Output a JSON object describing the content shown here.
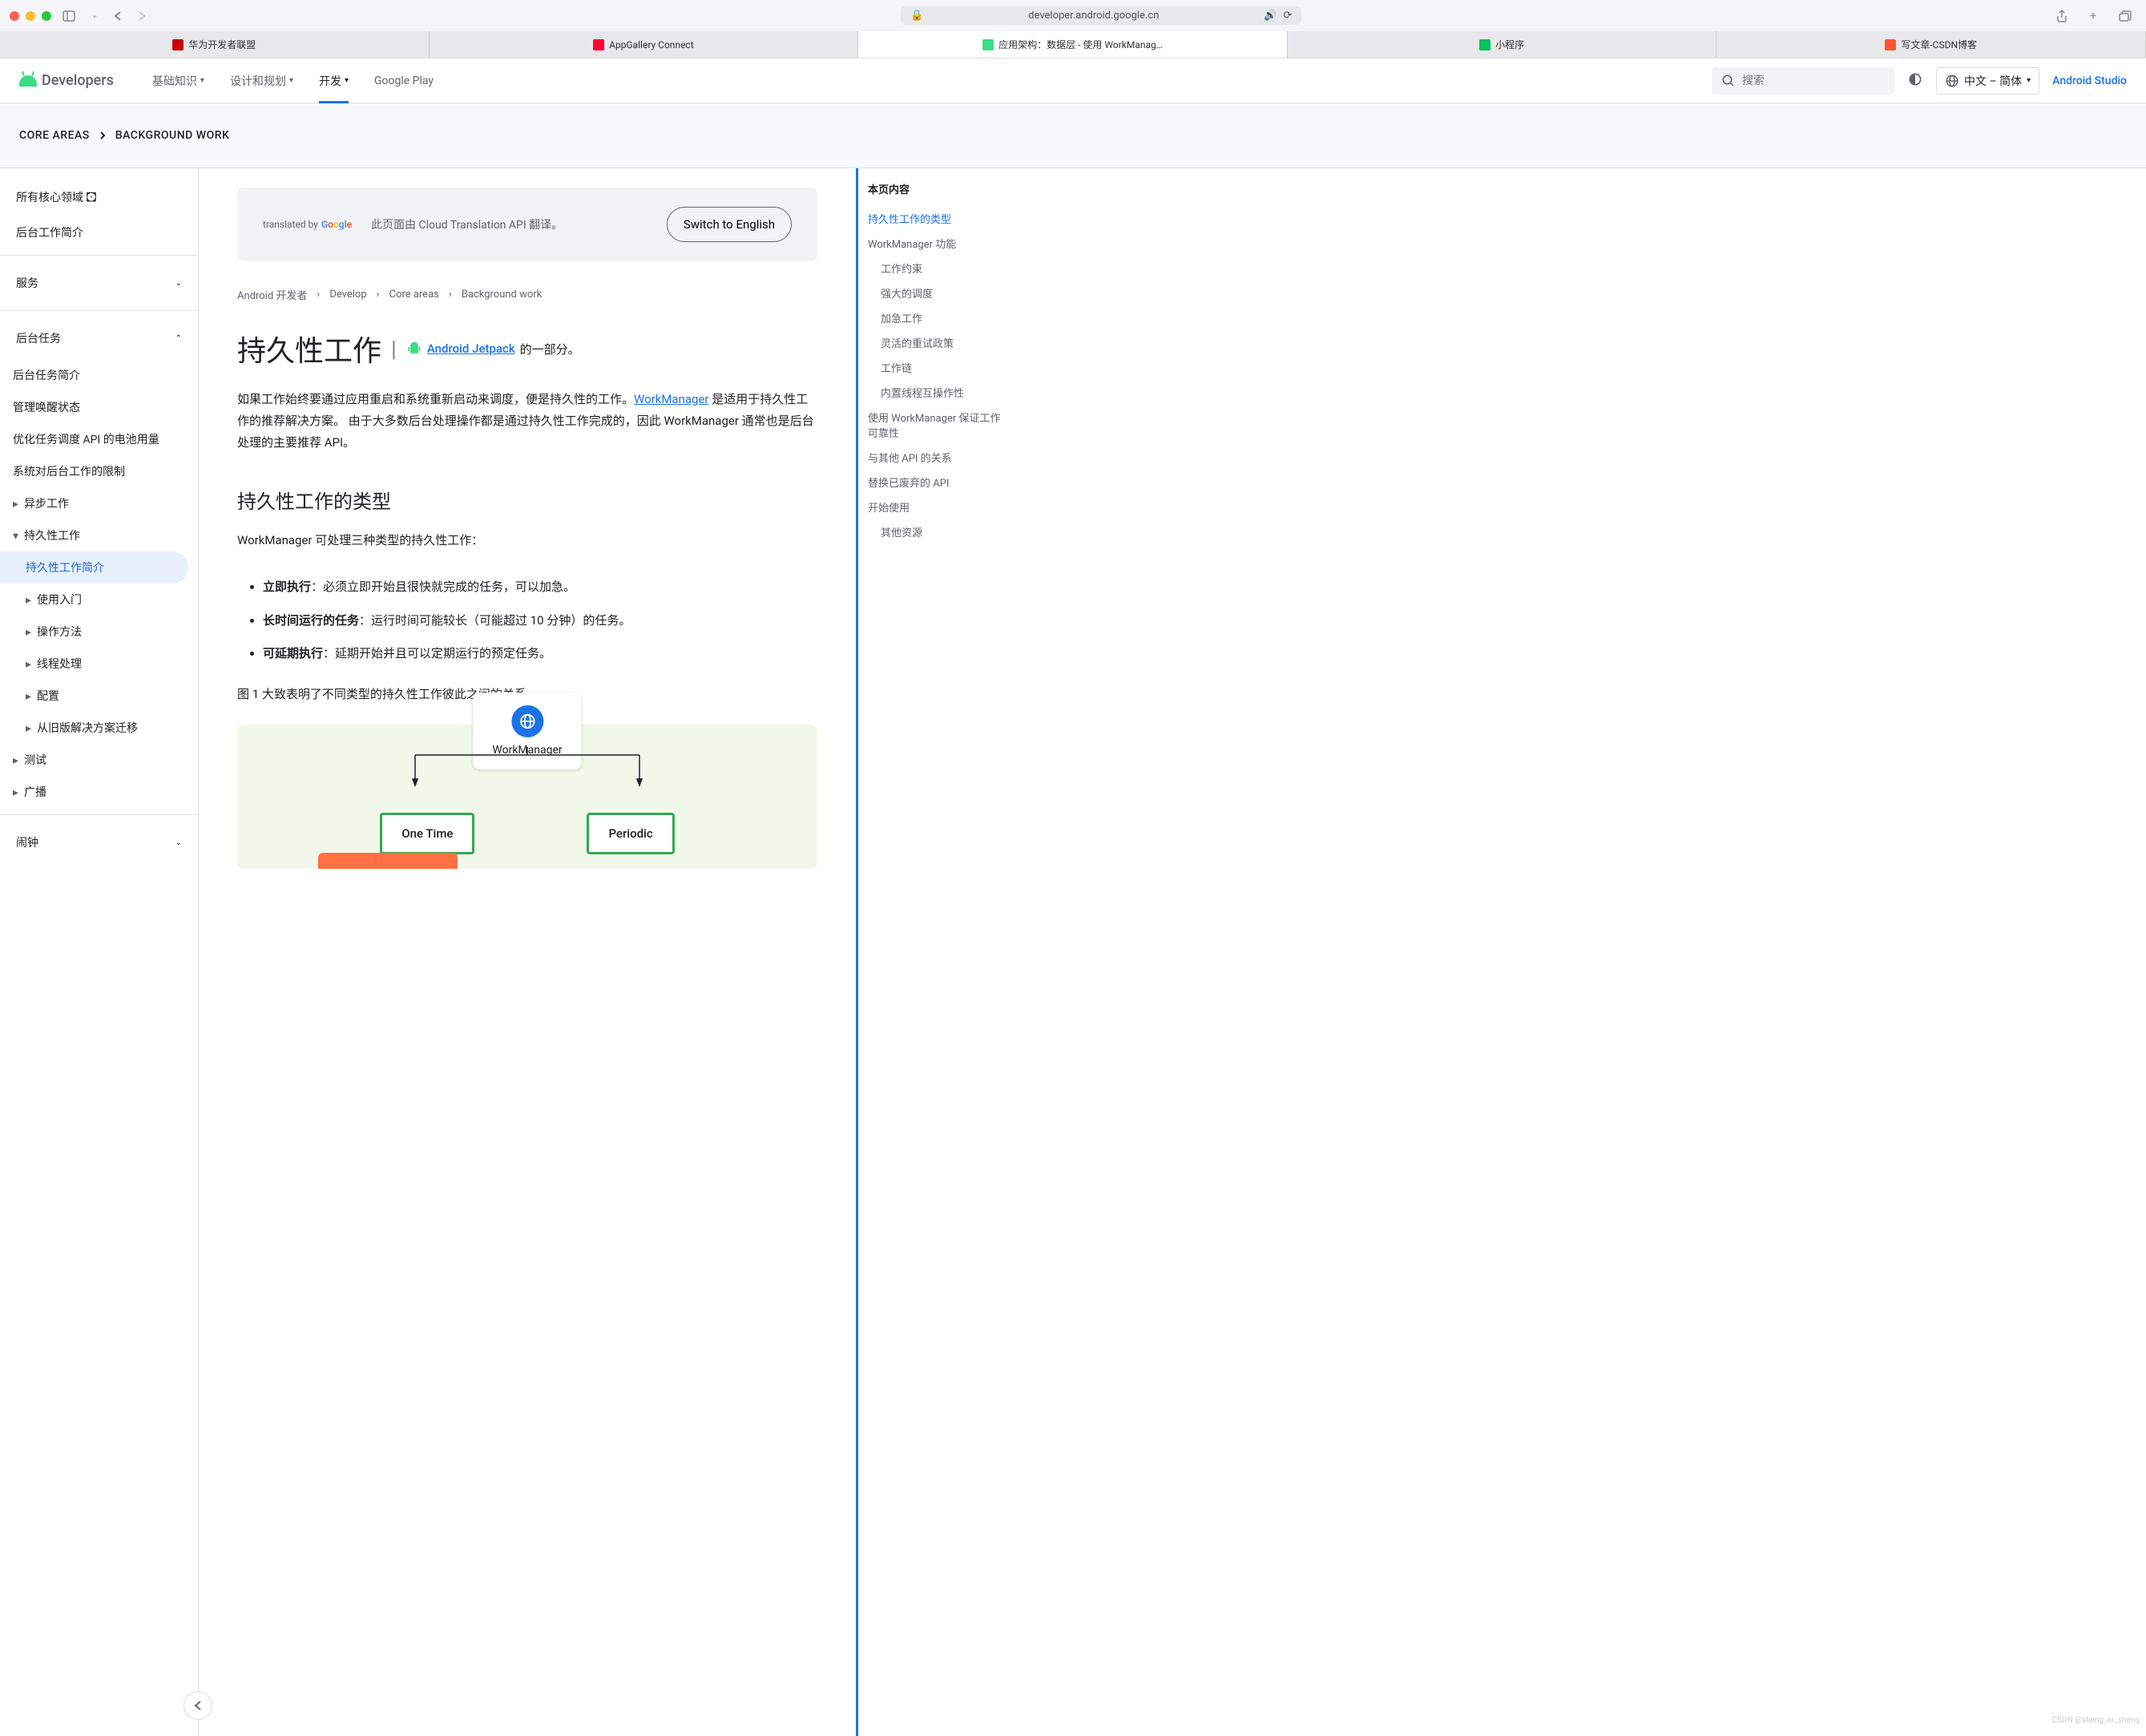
{
  "browser": {
    "url": "developer.android.google.cn",
    "tabs": [
      {
        "label": "华为开发者联盟",
        "color": "#c7000b"
      },
      {
        "label": "AppGallery Connect",
        "color": "#ff0033"
      },
      {
        "label": "应用架构：数据层 - 使用 WorkManag…",
        "color": "#3ddc84",
        "active": true
      },
      {
        "label": "小程序",
        "color": "#07c160"
      },
      {
        "label": "写文章-CSDN博客",
        "color": "#fc5531"
      }
    ]
  },
  "header": {
    "logo_text": "Developers",
    "nav": [
      {
        "label": "基础知识",
        "caret": true
      },
      {
        "label": "设计和规划",
        "caret": true
      },
      {
        "label": "开发",
        "caret": true,
        "active": true
      },
      {
        "label": "Google Play"
      }
    ],
    "search_placeholder": "搜索",
    "language": "中文 – 简体",
    "studio_link": "Android Studio"
  },
  "breadcrumb_bar": {
    "items": [
      "CORE AREAS",
      "BACKGROUND WORK"
    ]
  },
  "sidebar": {
    "top": [
      {
        "label": "所有核心领域 🖸"
      },
      {
        "label": "后台工作简介"
      }
    ],
    "services_label": "服务",
    "bg_tasks_label": "后台任务",
    "bg_tasks": [
      {
        "label": "后台任务简介"
      },
      {
        "label": "管理唤醒状态"
      },
      {
        "label": "优化任务调度 API 的电池用量"
      },
      {
        "label": "系统对后台工作的限制"
      }
    ],
    "async_label": "异步工作",
    "persistent_label": "持久性工作",
    "persistent_items": [
      {
        "label": "持久性工作简介",
        "selected": true
      },
      {
        "label": "使用入门",
        "expandable": true
      },
      {
        "label": "操作方法",
        "expandable": true
      },
      {
        "label": "线程处理",
        "expandable": true
      },
      {
        "label": "配置",
        "expandable": true
      },
      {
        "label": "从旧版解决方案迁移",
        "expandable": true
      }
    ],
    "testing_label": "测试",
    "broadcast_label": "广播",
    "alarm_label": "闹钟"
  },
  "translate": {
    "by": "translated by",
    "msg": "此页面由 Cloud Translation API 翻译。",
    "switch": "Switch to English"
  },
  "content_crumb": [
    "Android 开发者",
    "Develop",
    "Core areas",
    "Background work"
  ],
  "page_title": "持久性工作",
  "jetpack": {
    "link_text": "Android Jetpack",
    "suffix": " 的一部分。"
  },
  "intro": {
    "t1": "如果工作始终要通过应用重启和系统重新启动来调度，便是持久性的工作。",
    "link": "WorkManager",
    "t2": " 是适用于持久性工作的推荐解决方案。 由于大多数后台处理操作都是通过持久性工作完成的，因此 WorkManager 通常也是后台处理的主要推荐 API。"
  },
  "section1": {
    "heading": "持久性工作的类型",
    "intro": "WorkManager 可处理三种类型的持久性工作：",
    "bullets": [
      {
        "term": "立即执行",
        "desc": "：必须立即开始且很快就完成的任务，可以加急。"
      },
      {
        "term": "长时间运行的任务",
        "desc": "：运行时间可能较长（可能超过 10 分钟）的任务。"
      },
      {
        "term": "可延期执行",
        "desc": "：延期开始并且可以定期运行的预定任务。"
      }
    ],
    "figcap": "图 1 大致表明了不同类型的持久性工作彼此之间的关系。"
  },
  "diagram": {
    "wm_label": "WorkManager",
    "onetime": "One Time",
    "periodic": "Periodic"
  },
  "toc": {
    "title": "本页内容",
    "items": [
      {
        "label": "持久性工作的类型",
        "active": true
      },
      {
        "label": "WorkManager 功能"
      },
      {
        "label": "工作约束",
        "sub": true
      },
      {
        "label": "强大的调度",
        "sub": true
      },
      {
        "label": "加急工作",
        "sub": true
      },
      {
        "label": "灵活的重试政策",
        "sub": true
      },
      {
        "label": "工作链",
        "sub": true
      },
      {
        "label": "内置线程互操作性",
        "sub": true
      },
      {
        "label": "使用 WorkManager 保证工作可靠性"
      },
      {
        "label": "与其他 API 的关系"
      },
      {
        "label": "替换已废弃的 API"
      },
      {
        "label": "开始使用"
      },
      {
        "label": "其他资源",
        "sub": true
      }
    ]
  },
  "watermark": "CSDN @sheng_er_sheng"
}
